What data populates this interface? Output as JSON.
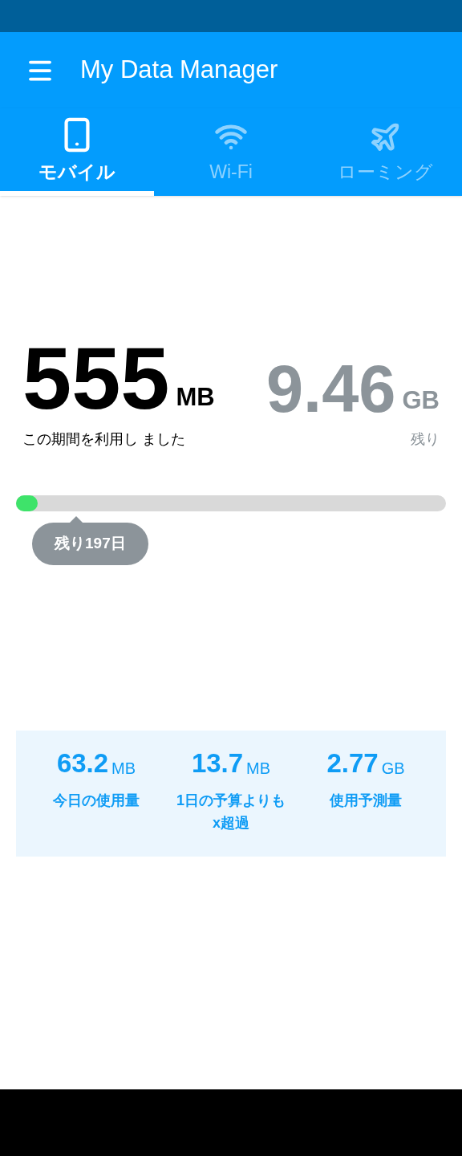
{
  "app_bar": {
    "title": "My Data Manager"
  },
  "tabs": [
    {
      "kind": "mobile",
      "label": "モバイル",
      "selected": true
    },
    {
      "kind": "wifi",
      "label": "Wi-Fi",
      "selected": false
    },
    {
      "kind": "roaming",
      "label": "ローミング",
      "selected": false
    }
  ],
  "usage": {
    "used": {
      "value": "555",
      "unit": "MB",
      "caption": "この期間を利用し ました"
    },
    "remaining": {
      "value": "9.46",
      "unit": "GB",
      "caption": "残り"
    }
  },
  "progress": {
    "level": 0.05,
    "tooltip": "残り197日"
  },
  "stats": [
    {
      "value": "63.2",
      "unit": "MB",
      "label": "今日の使用量"
    },
    {
      "value": "13.7",
      "unit": "MB",
      "label": "1日の予算よりもx超過"
    },
    {
      "value": "2.77",
      "unit": "GB",
      "label": "使用予測量"
    }
  ]
}
